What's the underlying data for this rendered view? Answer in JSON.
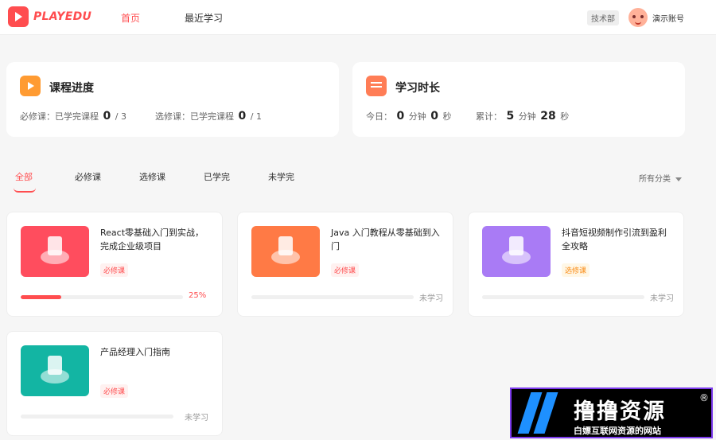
{
  "header": {
    "logo_text": "PLAYEDU",
    "nav": [
      "首页",
      "最近学习"
    ],
    "dept_badge": "技术部",
    "user_name": "演示账号"
  },
  "progress_card": {
    "title": "课程进度",
    "required_label": "必修课：已学完课程",
    "required_done": "0",
    "required_total": "/ 3",
    "optional_label": "选修课：已学完课程",
    "optional_done": "0",
    "optional_total": "/ 1"
  },
  "time_card": {
    "title": "学习时长",
    "today_label": "今日：",
    "today_min": "0",
    "min_unit": "分钟",
    "today_sec": "0",
    "sec_unit": "秒",
    "total_label": "累计：",
    "total_min": "5",
    "total_sec": "28"
  },
  "tabs": [
    "全部",
    "必修课",
    "选修课",
    "已学完",
    "未学完"
  ],
  "filter_label": "所有分类",
  "courses": [
    {
      "title": "React零基础入门到实战，完成企业级项目",
      "badge": "必修课",
      "progress_text": "25%",
      "progress": 0.25
    },
    {
      "title": "Java 入门教程从零基础到入门",
      "badge": "必修课",
      "progress_text": "未学习",
      "progress": 0
    },
    {
      "title": "抖音短视频制作引流到盈利全攻略",
      "badge": "选修课",
      "progress_text": "未学习",
      "progress": 0
    },
    {
      "title": "产品经理入门指南",
      "badge": "必修课",
      "progress_text": "未学习",
      "progress": 0
    }
  ],
  "watermark": {
    "title": "撸撸资源",
    "reg": "®",
    "subtitle": "白嫖互联网资源的网站"
  },
  "colors": {
    "accent": "#ff4d4f",
    "optional": "#fa8c16"
  }
}
